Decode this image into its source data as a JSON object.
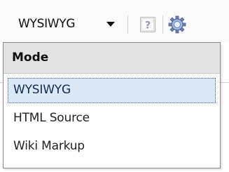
{
  "toolbar": {
    "mode_select": {
      "value": "WYSIWYG"
    },
    "icons": {
      "dropdown_arrow": "chevron-down-icon",
      "help": "help-icon",
      "settings": "settings-icon"
    }
  },
  "dropdown": {
    "header": "Mode",
    "options": [
      {
        "label": "WYSIWYG",
        "selected": true
      },
      {
        "label": "HTML Source",
        "selected": false
      },
      {
        "label": "Wiki Markup",
        "selected": false
      }
    ]
  },
  "colors": {
    "selected_background": "#dbe8f8",
    "selected_border": "#3a5f8f",
    "header_background": "#e3e3e3"
  }
}
